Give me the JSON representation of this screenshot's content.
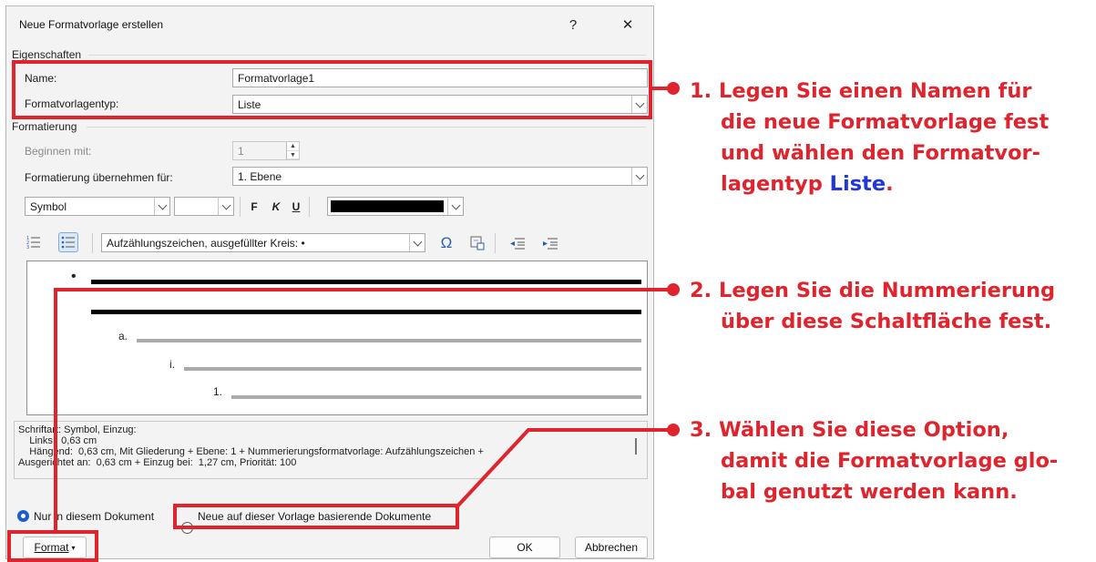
{
  "window": {
    "title": "Neue Formatvorlage erstellen",
    "help": "?",
    "close": "✕"
  },
  "eigenschaften": {
    "label": "Eigenschaften",
    "name_label": "Name:",
    "name_value": "Formatvorlage1",
    "type_label": "Formatvorlagentyp:",
    "type_value": "Liste"
  },
  "formatierung": {
    "label": "Formatierung",
    "begin_label": "Beginnen mit:",
    "begin_value": "1",
    "apply_label": "Formatierung übernehmen für:",
    "apply_value": "1. Ebene",
    "font_value": "Symbol",
    "size_value": "",
    "bold": "F",
    "italic": "K",
    "underline": "U",
    "color_value": "#000000"
  },
  "bullets": {
    "numbering_icon": "numbered-list-icon",
    "bullet_icon": "bulleted-list-icon",
    "selected_value": "Aufzählungszeichen, ausgefüllter Kreis: •",
    "symbol_glyph": "Ω"
  },
  "preview": {
    "bullet": "•",
    "level_a": "a.",
    "level_i": "i.",
    "level_1": "1."
  },
  "description": {
    "line1": "Schriftart: Symbol, Einzug:",
    "line2": "    Links:  0,63 cm",
    "line3": "    Hängend:  0,63 cm, Mit Gliederung + Ebene: 1 + Nummerierungsformatvorlage: Aufzählungszeichen +",
    "line4": "Ausgerichtet an:  0,63 cm + Einzug bei:  1,27 cm, Priorität: 100"
  },
  "scope": {
    "only_doc": "Nur in diesem Dokument",
    "new_docs": "Neue auf dieser Vorlage basierende Dokumente"
  },
  "buttons": {
    "format": "Format",
    "ok": "OK",
    "cancel": "Abbrechen"
  },
  "annotations": {
    "a1_line1": "1. Legen Sie einen Namen für",
    "a1_line2": "die neue Formatvorlage fest",
    "a1_line3": "und wählen den Formatvor-",
    "a1_line4_pre": "lagentyp ",
    "a1_line4_blue": "Liste",
    "a1_line4_post": ".",
    "a2_line1": "2. Legen Sie die Nummerierung",
    "a2_line2": "über diese Schaltfläche fest.",
    "a3_line1": "3. Wählen Sie diese Option,",
    "a3_line2": "damit die Formatvorlage glo-",
    "a3_line3": "bal genutzt werden kann."
  },
  "colors": {
    "highlight": "#e0242d",
    "accent_blue": "#2137d6",
    "radio_blue": "#1a5fc7"
  }
}
